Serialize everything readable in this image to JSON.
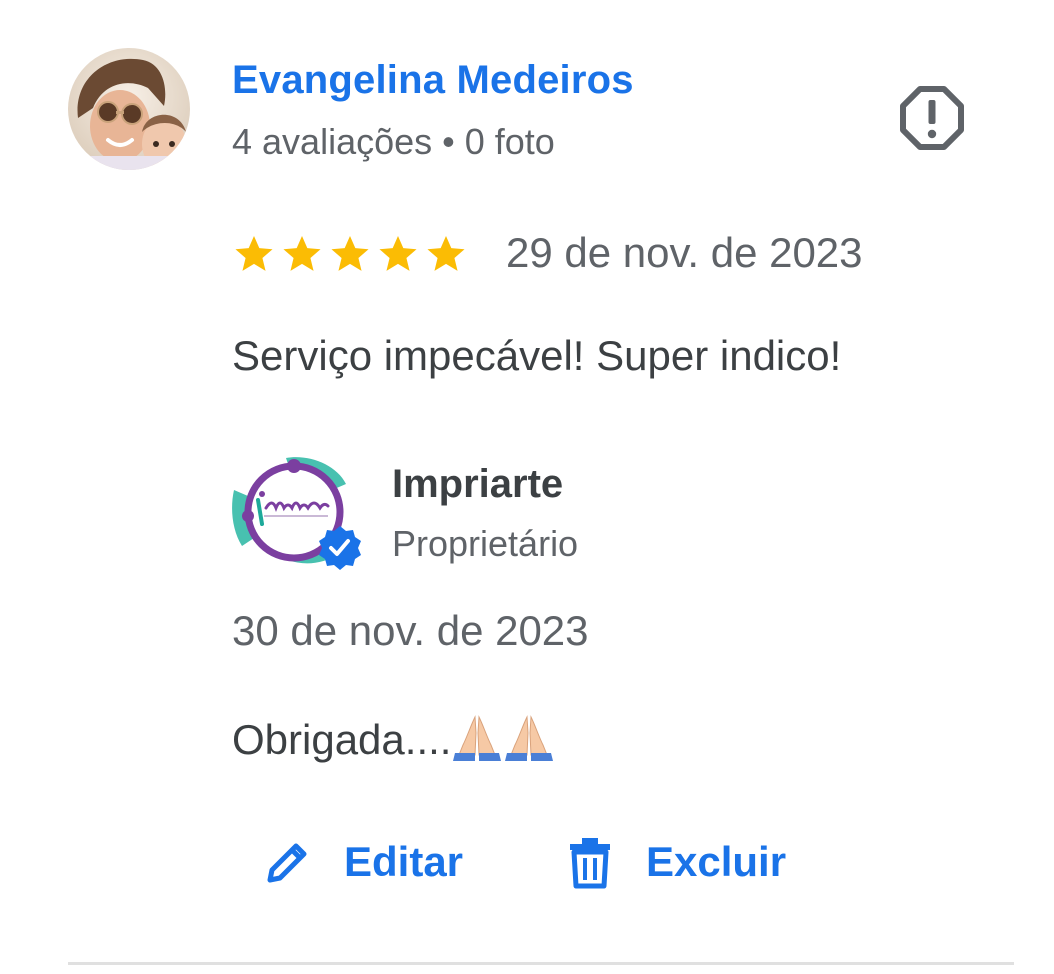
{
  "reviewer": {
    "name": "Evangelina Medeiros",
    "reviews_count": "4 avaliações",
    "separator": "•",
    "photos_count": "0 foto"
  },
  "review": {
    "rating": 5,
    "rating_max": 5,
    "date": "29 de nov. de 2023",
    "text": "Serviço impecável! Super indico!"
  },
  "owner_response": {
    "owner_name": "Impriarte",
    "owner_role": "Proprietário",
    "date": "30 de nov. de 2023",
    "text": "Obrigada....",
    "emoji": [
      "pray-icon",
      "pray-icon"
    ]
  },
  "actions": {
    "edit_label": "Editar",
    "delete_label": "Excluir"
  },
  "colors": {
    "link_blue": "#1a73e8",
    "star_gold": "#fbbc04",
    "text_primary": "#3c4043",
    "text_secondary": "#5f6368",
    "verified_blue": "#1a73e8",
    "logo_purple": "#7b3fa0",
    "logo_teal": "#48c1b0"
  },
  "icons": {
    "report": "report-octagon-icon",
    "edit": "pencil-icon",
    "delete": "trash-icon",
    "verified": "verified-badge-icon",
    "star": "star-icon"
  }
}
